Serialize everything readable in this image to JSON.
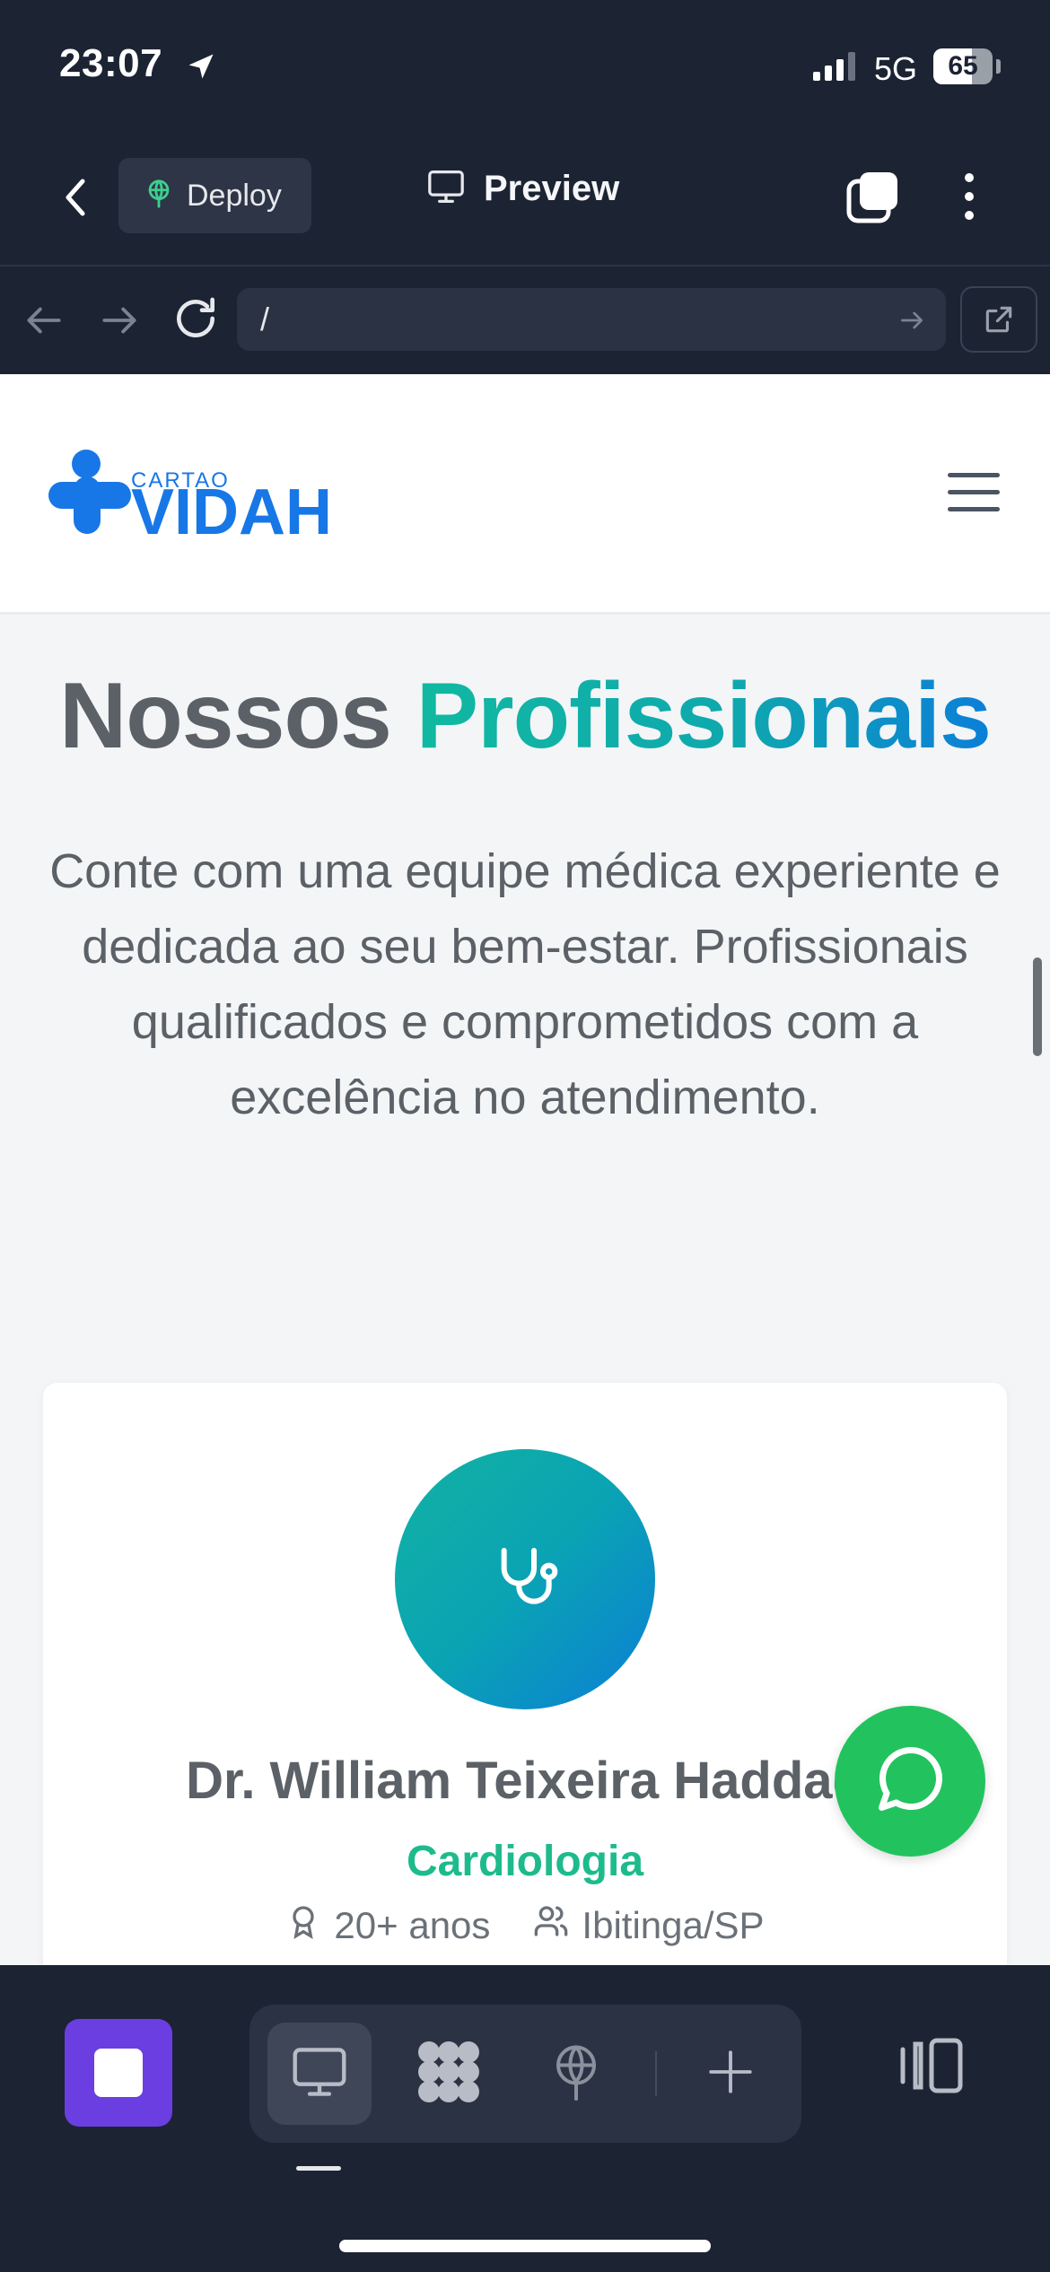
{
  "status_bar": {
    "time": "23:07",
    "network": "5G",
    "battery": "65",
    "battery_level": 0.65
  },
  "header": {
    "deploy_label": "Deploy",
    "title": "Preview"
  },
  "url_bar": {
    "url": "/"
  },
  "site": {
    "logo": {
      "small": "CARTAO",
      "big": "VIDAH"
    },
    "hero": {
      "title_part1": "Nossos",
      "title_part2": "Profissionais",
      "subtitle": "Conte com uma equipe médica experiente e dedicada ao seu bem-estar. Profissionais qualificados e comprometidos com a excelência no atendimento."
    },
    "card": {
      "name": "Dr. William Teixeira Haddad",
      "specialty": "Cardiologia",
      "experience": "20+ anos",
      "location": "Ibitinga/SP"
    }
  },
  "colors": {
    "accent_teal": "#10b9a1",
    "accent_blue": "#0b7fd8",
    "whatsapp": "#22c35e",
    "stop": "#6a3ee0"
  }
}
